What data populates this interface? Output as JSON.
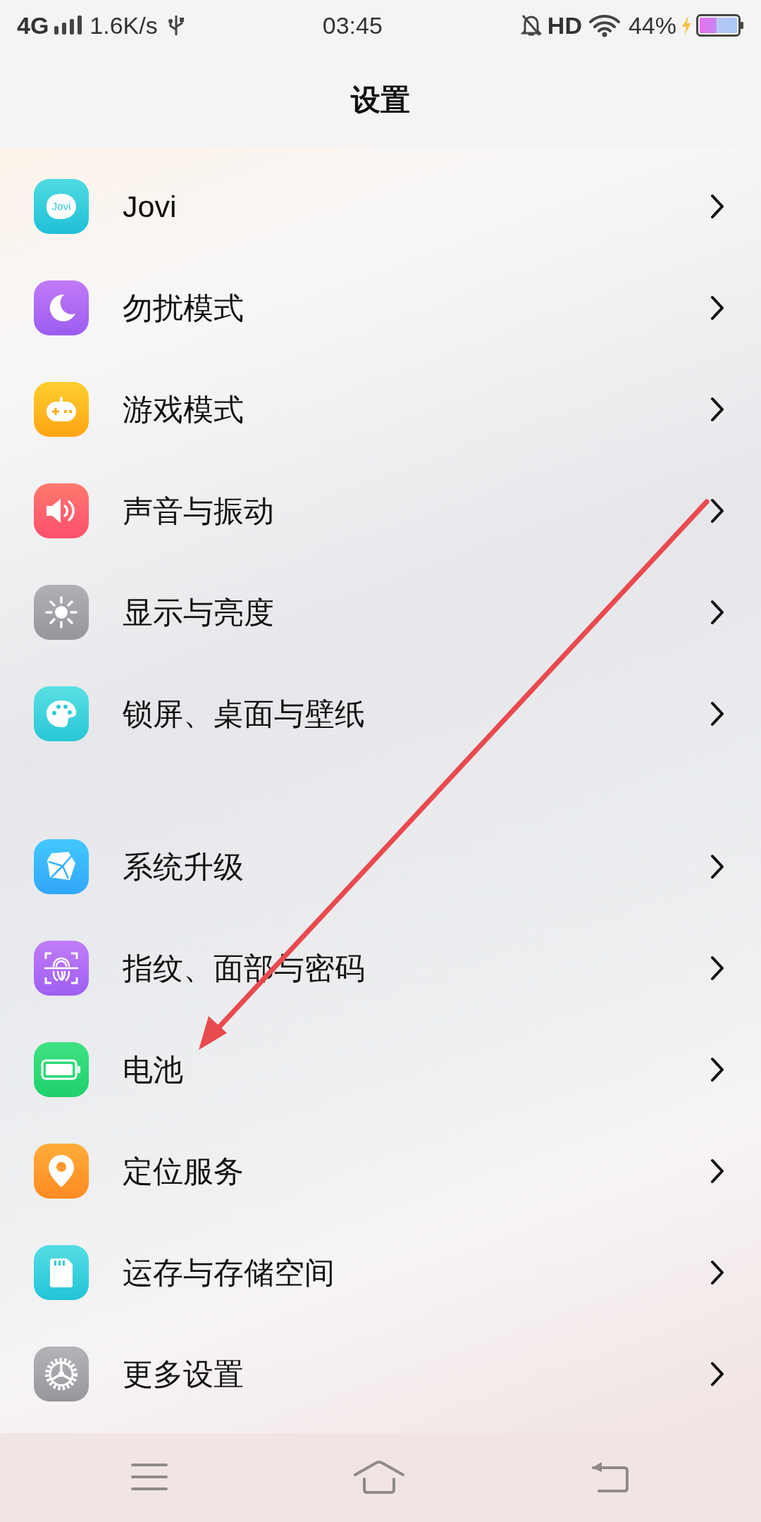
{
  "status_bar": {
    "network": "4G",
    "speed": "1.6K/s",
    "time": "03:45",
    "hd": "HD",
    "battery": "44%",
    "charging": true
  },
  "title": "设置",
  "groups": [
    [
      {
        "label": "Jovi",
        "icon_text": "Jovi"
      },
      {
        "label": "勿扰模式"
      },
      {
        "label": "游戏模式"
      },
      {
        "label": "声音与振动"
      },
      {
        "label": "显示与亮度"
      },
      {
        "label": "锁屏、桌面与壁纸"
      }
    ],
    [
      {
        "label": "系统升级"
      },
      {
        "label": "指纹、面部与密码"
      },
      {
        "label": "电池"
      },
      {
        "label": "定位服务"
      },
      {
        "label": "运存与存储空间"
      },
      {
        "label": "更多设置"
      }
    ]
  ],
  "annotation": {
    "kind": "arrow",
    "color": "#e84a4f"
  }
}
